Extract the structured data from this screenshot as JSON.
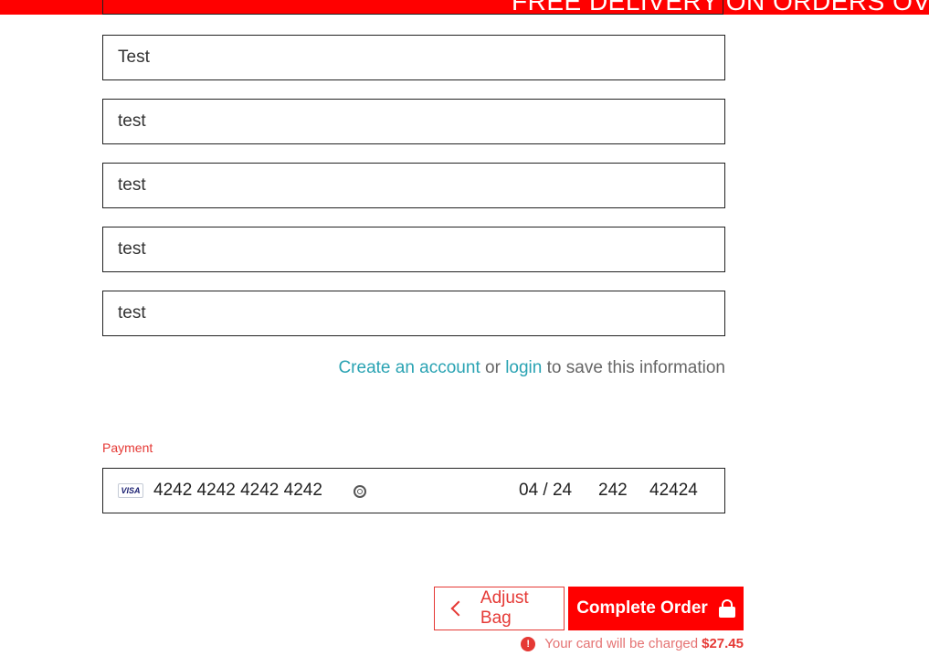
{
  "banner": {
    "text": "FREE DELIVERY ON ORDERS OVE"
  },
  "form": {
    "fields": [
      {
        "value": "Test"
      },
      {
        "value": "test"
      },
      {
        "value": "test"
      },
      {
        "value": "test"
      },
      {
        "value": "test"
      }
    ],
    "save_info": {
      "create_account_link": "Create an account",
      "or_text": "or",
      "login_link": "login",
      "suffix": "to save this information"
    }
  },
  "payment": {
    "label": "Payment",
    "card_brand": "VISA",
    "card_number": "4242 4242 4242 4242",
    "expiry": "04 / 24",
    "cvc": "242",
    "zip": "42424"
  },
  "actions": {
    "adjust_bag_label": "Adjust Bag",
    "complete_order_label": "Complete Order",
    "charge_text": "Your card will be charged",
    "charge_amount": "$27.45"
  },
  "colors": {
    "brand_red": "#ff0000",
    "link_teal": "#2aa3b3",
    "error_red": "#e53935"
  }
}
